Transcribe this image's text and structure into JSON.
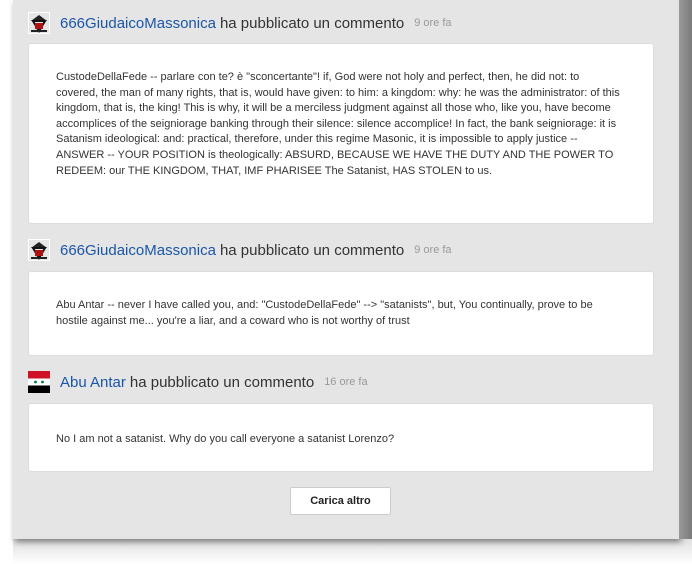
{
  "comments": [
    {
      "author": "666GiudaicoMassonica",
      "action": "ha pubblicato un commento",
      "time": "9 ore fa",
      "avatar_icon": "masonic-emblem-icon",
      "text": "CustodeDellaFede -- parlare con te? è \"sconcertante\"! if, God were not holy and perfect, then, he did not: to covered, the man of many rights, that is, would have given: to him: a kingdom: why: he was the administrator: of this kingdom, that is, the king! This is why, it will be a merciless judgment against all those who, like you, have become accomplices of the seigniorage banking through their silence: silence accomplice! In fact, the bank seigniorage: it is Satanism ideological: and: practical, therefore, under this regime Masonic, it is impossible to apply justice -- ANSWER -- YOUR POSITION is theologically: ABSURD, BECAUSE WE HAVE THE DUTY AND THE POWER TO REDEEM: our THE KINGDOM, THAT, IMF PHARISEE The Satanist, HAS STOLEN to us."
    },
    {
      "author": "666GiudaicoMassonica",
      "action": "ha pubblicato un commento",
      "time": "9 ore fa",
      "avatar_icon": "masonic-emblem-icon",
      "text": "Abu Antar -- never I have called you, and: \"CustodeDellaFede\" --> \"satanists\", but, You continually, prove to be hostile against me... you're a liar, and a coward who is not worthy of trust"
    },
    {
      "author": "Abu Antar",
      "action": "ha pubblicato un commento",
      "time": "16 ore fa",
      "avatar_icon": "syria-flag-icon",
      "text": "No I am not a satanist. Why do you call everyone a satanist Lorenzo?"
    }
  ],
  "load_more_label": "Carica altro",
  "colors": {
    "author_link": "#1a56a8",
    "panel_background": "#e5e5e5",
    "card_background": "#ffffff",
    "timestamp": "#999999"
  }
}
